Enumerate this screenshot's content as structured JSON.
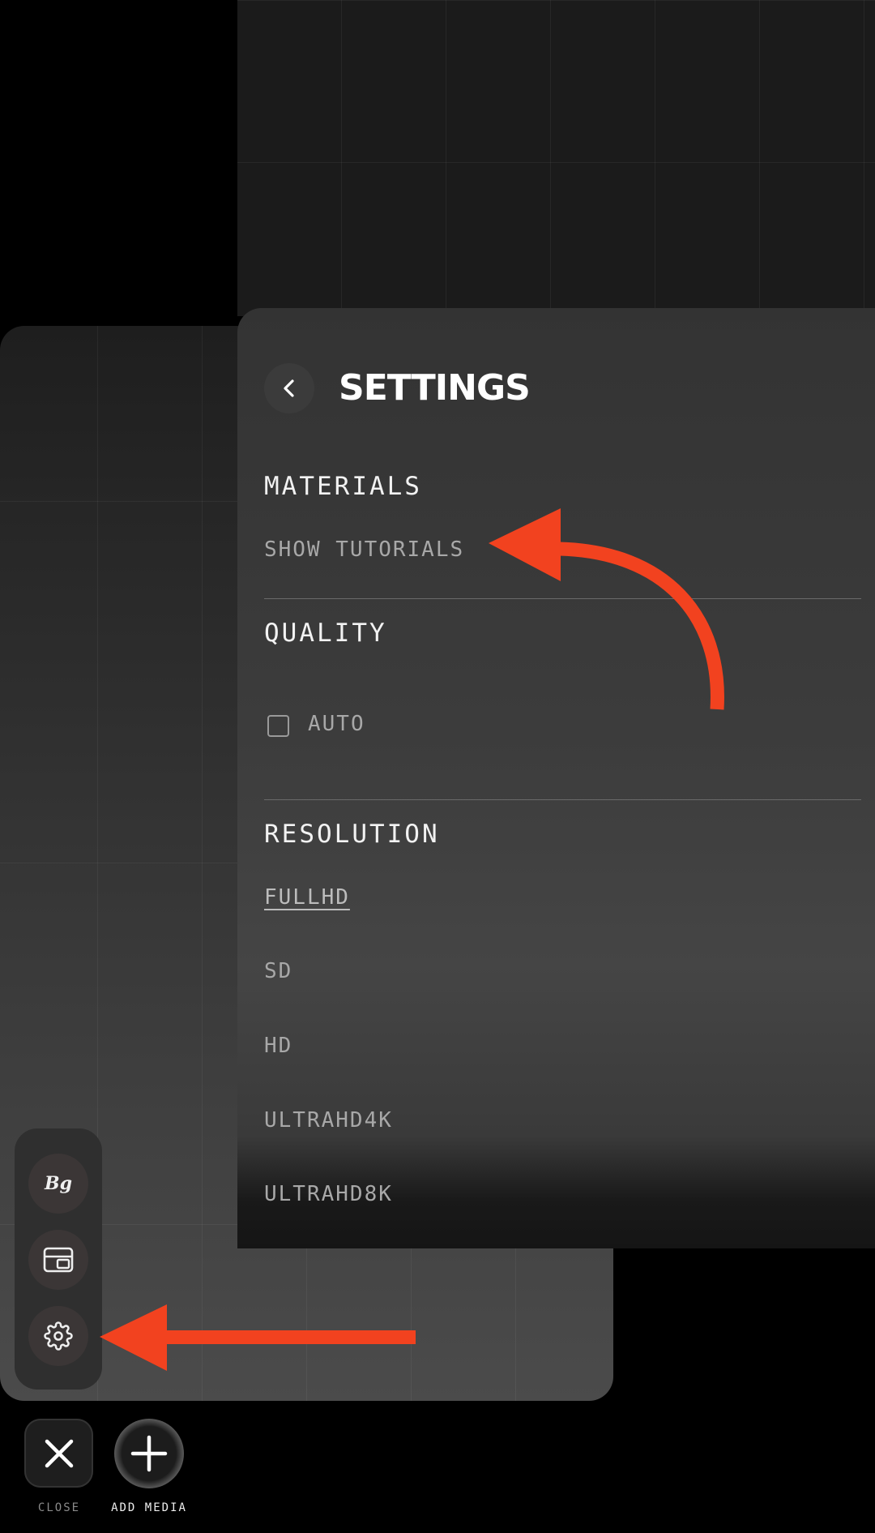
{
  "settings": {
    "title": "SETTINGS",
    "materials": {
      "heading": "MATERIALS",
      "show_tutorials": "SHOW TUTORIALS"
    },
    "quality": {
      "heading": "QUALITY",
      "auto_label": "AUTO",
      "auto_checked": false
    },
    "resolution": {
      "heading": "RESOLUTION",
      "selected": "FULLHD",
      "options": [
        "FULLHD",
        "SD",
        "HD",
        "ULTRAHD4K",
        "ULTRAHD8K"
      ]
    }
  },
  "tools": {
    "bg_label": "Bg",
    "icons": [
      "background-icon",
      "layout-icon",
      "gear-icon"
    ]
  },
  "bottom_bar": {
    "close_label": "CLOSE",
    "add_media_label": "ADD MEDIA"
  },
  "colors": {
    "annotation_arrow": "#f2421f",
    "panel": "#3c3c3c",
    "background": "#000000"
  }
}
